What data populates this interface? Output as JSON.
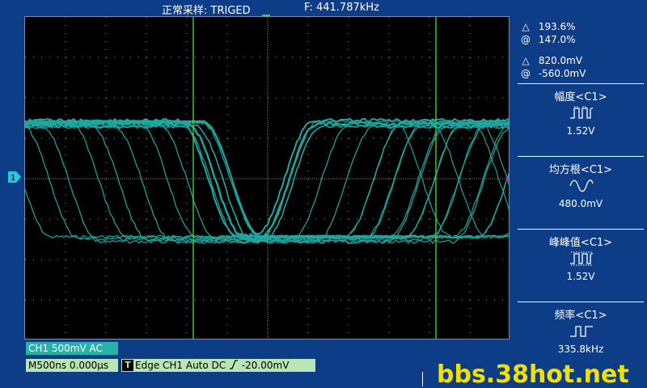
{
  "header": {
    "status": "正常采样: TRIGED",
    "frequency": "F:  441.787kHz"
  },
  "channel_marker": "1",
  "cursors": [
    {
      "symbol": "△",
      "value": "193.6%"
    },
    {
      "symbol": "@",
      "value": "147.0%"
    },
    {
      "symbol": "△",
      "value": "820.0mV"
    },
    {
      "symbol": "@",
      "value": "-560.0mV"
    }
  ],
  "measurements": [
    {
      "title": "幅度<C1>",
      "icon": "amplitude-icon",
      "value": "1.52V"
    },
    {
      "title": "均方根<C1>",
      "icon": "rms-icon",
      "value": "480.0mV"
    },
    {
      "title": "峰峰值<C1>",
      "icon": "peak-to-peak-icon",
      "value": "1.52V"
    },
    {
      "title": "频率<C1>",
      "icon": "frequency-icon",
      "value": "335.8kHz"
    }
  ],
  "bottom": {
    "ch1": "CH1  500mV  AC",
    "timebase": "M500ns  0.000μs",
    "trigger_t": "T",
    "trigger": "Edge  CH1  Auto  DC",
    "trigger_level": "-20.00mV"
  },
  "watermark": "bbs.38hot.net",
  "colors": {
    "background": "#0d3d86",
    "trace": "#1fa7a0",
    "cursor": "#3fd13f",
    "grid": "#9a9a9a",
    "label_bg": "#23b3a8",
    "timebase_bg": "#b9e4b3",
    "watermark": "#f2e000"
  }
}
